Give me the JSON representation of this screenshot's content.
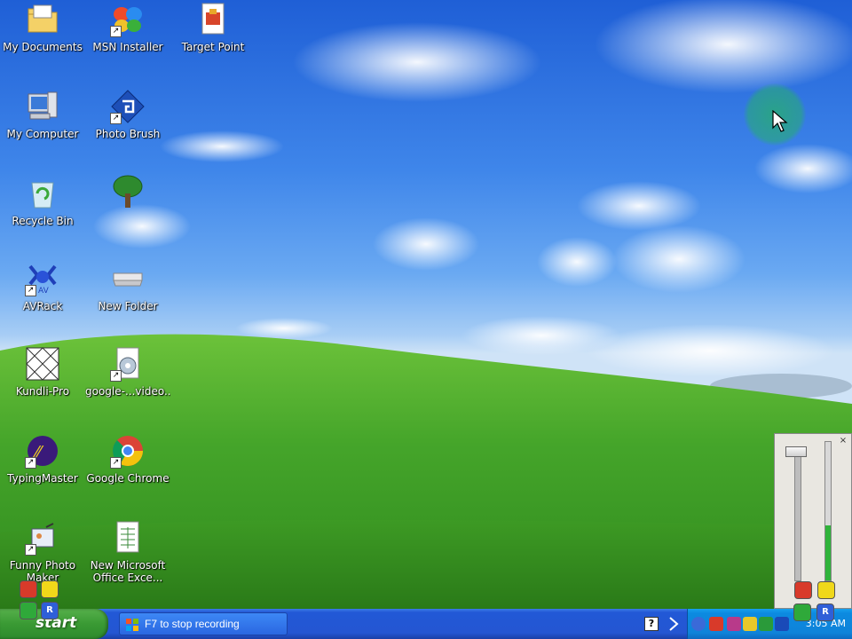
{
  "desktop": {
    "icons": [
      {
        "label": "My Documents",
        "icon": "folder-documents-icon"
      },
      {
        "label": "MSN Installer",
        "icon": "msn-butterfly-icon"
      },
      {
        "label": "Target Point",
        "icon": "target-point-icon"
      },
      {
        "label": "My Computer",
        "icon": "computer-icon"
      },
      {
        "label": "Photo Brush",
        "icon": "photo-brush-icon"
      },
      {
        "label": "Recycle Bin",
        "icon": "recycle-bin-icon"
      },
      {
        "label": "",
        "icon": "tree-icon"
      },
      {
        "label": "AVRack",
        "icon": "avrack-icon"
      },
      {
        "label": "New Folder",
        "icon": "folder-icon"
      },
      {
        "label": "Kundli-Pro",
        "icon": "kundli-icon"
      },
      {
        "label": "google-...video...",
        "icon": "google-video-icon"
      },
      {
        "label": "TypingMaster",
        "icon": "typingmaster-icon"
      },
      {
        "label": "Google Chrome",
        "icon": "chrome-icon"
      },
      {
        "label": "Funny Photo Maker",
        "icon": "funny-photo-icon"
      },
      {
        "label": "New Microsoft Office Exce...",
        "icon": "excel-document-icon"
      }
    ]
  },
  "recorder": {
    "close_glyph": "×",
    "level_fraction": 0.4,
    "buttons": {
      "red": "",
      "yellow": "",
      "green": "",
      "blue": "R"
    }
  },
  "taskbar": {
    "start_label": "start",
    "task_item_label": "F7 to stop recording",
    "help_glyph": "?",
    "clock": "3:05 AM"
  },
  "colors": {
    "taskbar_blue": "#2456d2",
    "start_green": "#3a9a34",
    "tray_blue": "#0f83d9"
  }
}
